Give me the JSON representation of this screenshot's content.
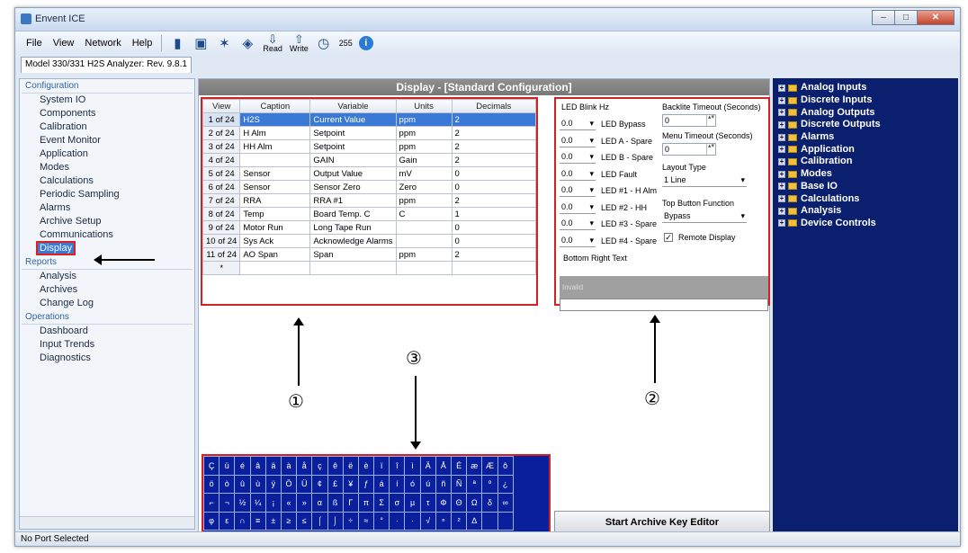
{
  "window": {
    "title": "Envent ICE"
  },
  "menu": [
    "File",
    "View",
    "Network",
    "Help"
  ],
  "toolbar": {
    "read_label": "Read",
    "write_label": "Write",
    "count": "255"
  },
  "tab": "Model 330/331 H2S Analyzer: Rev. 9.8.1",
  "nav": {
    "config_header": "Configuration",
    "config_items": [
      "System IO",
      "Components",
      "Calibration",
      "Event Monitor",
      "Application",
      "Modes",
      "Calculations",
      "Periodic Sampling",
      "Alarms",
      "Archive Setup",
      "Communications"
    ],
    "selected": "Display",
    "reports_header": "Reports",
    "reports_items": [
      "Analysis",
      "Archives",
      "Change Log"
    ],
    "operations_header": "Operations",
    "operations_items": [
      "Dashboard",
      "Input Trends",
      "Diagnostics"
    ]
  },
  "display": {
    "title": "Display - [Standard Configuration]"
  },
  "grid": {
    "headers": [
      "View",
      "Caption",
      "Variable",
      "Units",
      "Decimals"
    ],
    "rows": [
      [
        "1 of 24",
        "H2S",
        "Current Value",
        "ppm",
        "2"
      ],
      [
        "2 of 24",
        "H Alm",
        "Setpoint",
        "ppm",
        "2"
      ],
      [
        "3 of 24",
        "HH Alm",
        "Setpoint",
        "ppm",
        "2"
      ],
      [
        "4 of 24",
        "",
        "GAIN",
        "Gain",
        "2"
      ],
      [
        "5 of 24",
        "Sensor",
        "Output Value",
        "mV",
        "0"
      ],
      [
        "6 of 24",
        "Sensor",
        "Sensor Zero",
        "Zero",
        "0"
      ],
      [
        "7 of 24",
        "RRA",
        "RRA #1",
        "ppm",
        "2"
      ],
      [
        "8 of 24",
        "Temp",
        "Board Temp. C",
        "C",
        "1"
      ],
      [
        "9 of 24",
        "Motor Run",
        "Long Tape Run",
        "",
        "0"
      ],
      [
        "10 of 24",
        "Sys Ack",
        "Acknowledge Alarms",
        "",
        "0"
      ],
      [
        "11 of 24",
        "AO Span",
        "Span",
        "ppm",
        "2"
      ],
      [
        "*",
        "",
        "",
        "",
        ""
      ]
    ]
  },
  "props": {
    "led_blink_label": "LED Blink Hz",
    "leds": [
      {
        "val": "0.0",
        "label": "LED Bypass"
      },
      {
        "val": "0.0",
        "label": "LED A - Spare"
      },
      {
        "val": "0.0",
        "label": "LED B - Spare"
      },
      {
        "val": "0.0",
        "label": "LED Fault"
      },
      {
        "val": "0.0",
        "label": "LED #1 - H Alm"
      },
      {
        "val": "0.0",
        "label": "LED #2 - HH"
      },
      {
        "val": "0.0",
        "label": "LED #3 - Spare"
      },
      {
        "val": "0.0",
        "label": "LED #4 - Spare"
      }
    ],
    "backlite_label": "Backlite Timeout (Seconds)",
    "backlite_value": "0",
    "menu_timeout_label": "Menu Timeout (Seconds)",
    "menu_timeout_value": "0",
    "layout_label": "Layout Type",
    "layout_value": "1 Line",
    "top_button_label": "Top Button Function",
    "top_button_value": "Bypass",
    "remote_display_label": "Remote Display",
    "bottom_right_label": "Bottom Right Text",
    "invalid_text": "Invalid"
  },
  "chars": [
    [
      "Ç",
      "ü",
      "é",
      "â",
      "ä",
      "à",
      "å",
      "ç",
      "ê",
      "ë",
      "è",
      "ï",
      "î",
      "ì",
      "Ä",
      "Å",
      "É",
      "æ",
      "Æ",
      "ô"
    ],
    [
      "ö",
      "ò",
      "û",
      "ù",
      "ÿ",
      "Ö",
      "Ü",
      "¢",
      "£",
      "¥",
      "ƒ",
      "á",
      "í",
      "ó",
      "ú",
      "ñ",
      "Ñ",
      "ª",
      "º",
      "¿"
    ],
    [
      "⌐",
      "¬",
      "½",
      "¼",
      "¡",
      "«",
      "»",
      "α",
      "ß",
      "Γ",
      "π",
      "Σ",
      "σ",
      "µ",
      "τ",
      "Φ",
      "Θ",
      "Ω",
      "δ",
      "∞"
    ],
    [
      "φ",
      "ε",
      "∩",
      "≡",
      "±",
      "≥",
      "≤",
      "⌠",
      "⌡",
      "÷",
      "≈",
      "°",
      "∙",
      "·",
      "√",
      "ⁿ",
      "²",
      "∆",
      "",
      ""
    ]
  ],
  "archive_button": "Start Archive Key Editor",
  "callouts": {
    "one": "①",
    "two": "②",
    "three": "③"
  },
  "tree": [
    "Analog Inputs",
    "Discrete Inputs",
    "Analog Outputs",
    "Discrete Outputs",
    "Alarms",
    "Application",
    "Calibration",
    "Modes",
    "Base IO",
    "Calculations",
    "Analysis",
    "Device Controls"
  ],
  "status": "No Port Selected"
}
